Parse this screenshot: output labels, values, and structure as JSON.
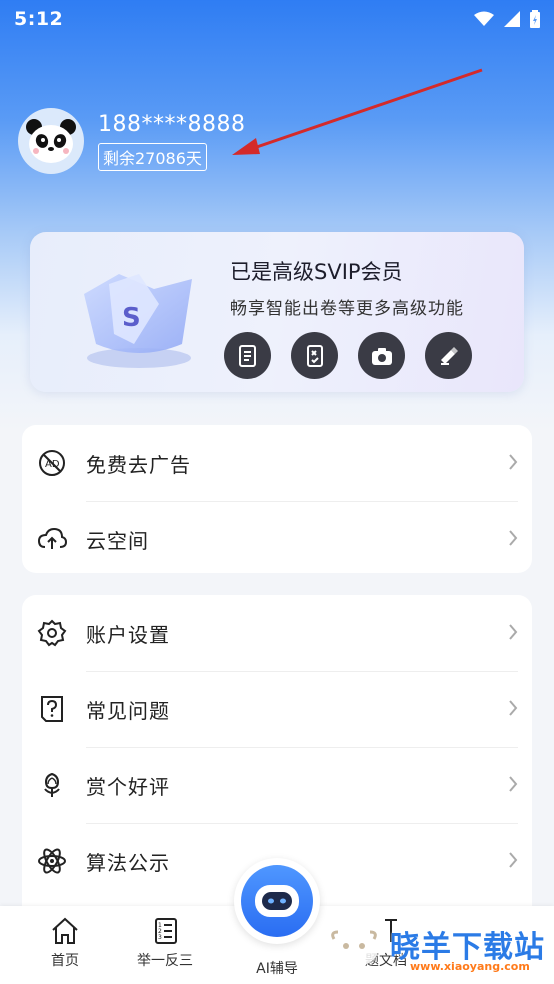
{
  "status_bar": {
    "time": "5:12"
  },
  "profile": {
    "phone": "188****8888",
    "remaining": "剩余27086天"
  },
  "vip": {
    "title": "已是高级SVIP会员",
    "subtitle": "畅享智能出卷等更多高级功能",
    "tools": [
      "document-icon",
      "exam-sheet-icon",
      "camera-icon",
      "eraser-pencil-icon"
    ]
  },
  "menu_group_1": [
    {
      "label": "免费去广告",
      "icon": "no-ads-icon"
    },
    {
      "label": "云空间",
      "icon": "cloud-upload-icon"
    }
  ],
  "menu_group_2": [
    {
      "label": "账户设置",
      "icon": "gear-icon"
    },
    {
      "label": "常见问题",
      "icon": "question-icon"
    },
    {
      "label": "赏个好评",
      "icon": "flower-icon"
    },
    {
      "label": "算法公示",
      "icon": "atom-icon"
    }
  ],
  "tabbar": {
    "tabs": [
      {
        "label": "首页",
        "icon": "home-icon"
      },
      {
        "label": "举一反三",
        "icon": "list-doc-icon"
      },
      {
        "label": "AI辅导",
        "icon": "robot-icon"
      },
      {
        "label": "题文档",
        "icon": "doc-icon"
      }
    ]
  },
  "watermark": {
    "text": "晓羊下载站",
    "url": "www.xiaoyang.com"
  },
  "colors": {
    "accent": "#2f7df3",
    "vip_icon_bg": "#3a3b45",
    "arrow": "#d42a2a"
  }
}
